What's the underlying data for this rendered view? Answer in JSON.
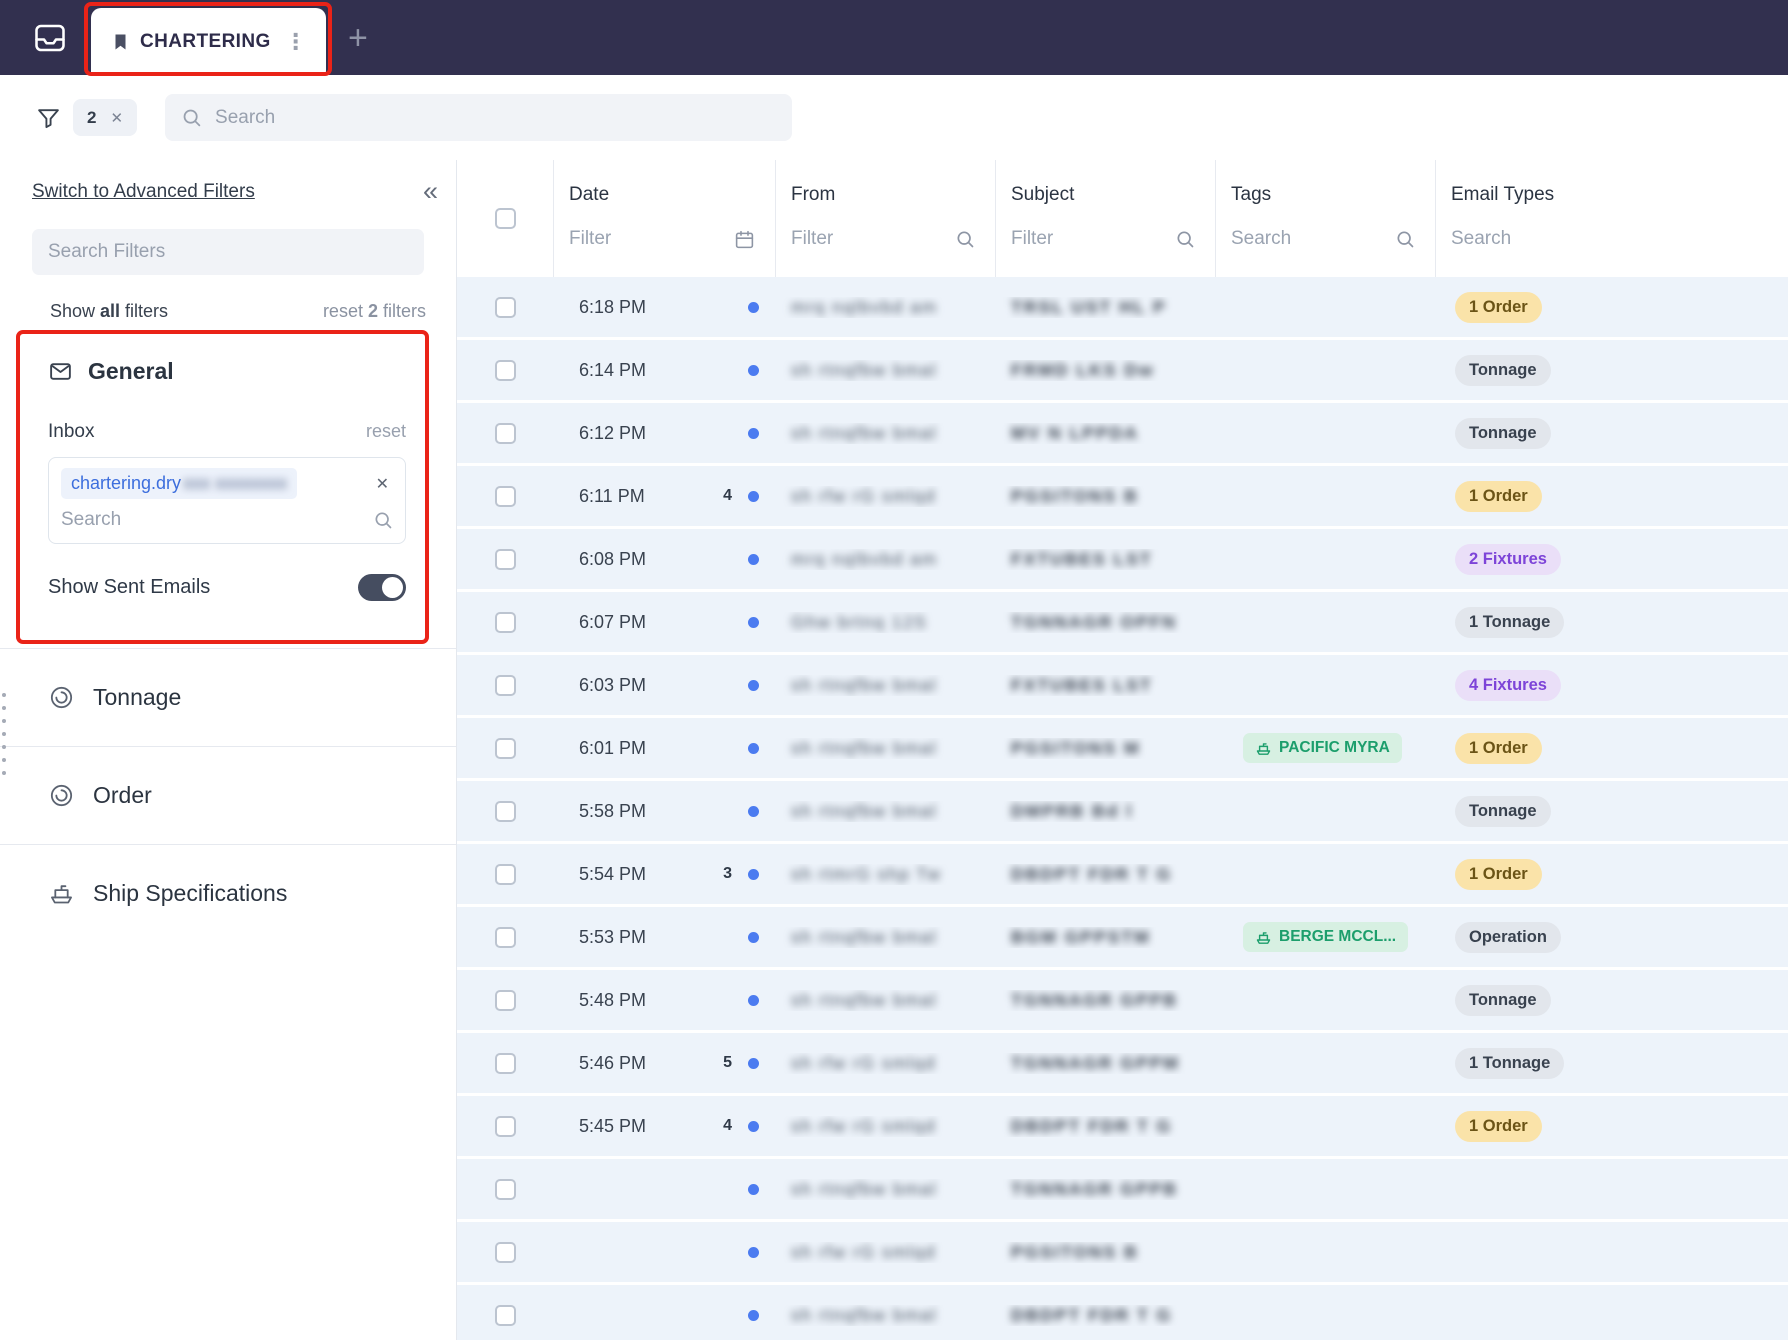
{
  "glyphs": {
    "collapse": "«",
    "kebab": "⋮",
    "plus": "+",
    "close": "✕"
  },
  "topbar": {
    "tab_label": "CHARTERING"
  },
  "filterbar": {
    "filter_count": "2",
    "search_placeholder": "Search"
  },
  "sidebar": {
    "advanced_filters_link": "Switch to Advanced Filters",
    "search_filters_placeholder": "Search Filters",
    "show_filters": {
      "pre": "Show ",
      "bold": "all",
      "post": " filters"
    },
    "reset_filters": {
      "pre": "reset ",
      "bold": "2",
      "post": " filters"
    },
    "general": {
      "title": "General",
      "inbox_label": "Inbox",
      "reset_label": "reset",
      "inbox_chip_text": "chartering.dry",
      "inbox_chip_redacted": "xxx xxxxxxxx",
      "inbox_search_placeholder": "Search",
      "show_sent_label": "Show Sent Emails",
      "show_sent_on": true
    },
    "sections": [
      {
        "label": "Tonnage",
        "icon": "spiral-icon"
      },
      {
        "label": "Order",
        "icon": "spiral-icon"
      },
      {
        "label": "Ship Specifications",
        "icon": "ship-icon"
      }
    ]
  },
  "table": {
    "columns": [
      {
        "label": "Date",
        "filter_placeholder": "Filter",
        "icon": "calendar-icon"
      },
      {
        "label": "From",
        "filter_placeholder": "Filter",
        "icon": "search-icon"
      },
      {
        "label": "Subject",
        "filter_placeholder": "Filter",
        "icon": "search-icon"
      },
      {
        "label": "Tags",
        "filter_placeholder": "Search",
        "icon": "search-icon"
      },
      {
        "label": "Email Types",
        "filter_placeholder": "Search",
        "icon": ""
      }
    ],
    "rows": [
      {
        "time": "6:18 PM",
        "count": "",
        "unread": true,
        "from_redacted": "mrq nqlbvbd am",
        "subject_redacted": "TRSL UST HL P",
        "tag": "",
        "type": "1 Order",
        "type_variant": "amber"
      },
      {
        "time": "6:14 PM",
        "count": "",
        "unread": true,
        "from_redacted": "sh rtnqfbw bmal",
        "subject_redacted": "FRMD LKS Dw",
        "tag": "",
        "type": "Tonnage",
        "type_variant": "gray"
      },
      {
        "time": "6:12 PM",
        "count": "",
        "unread": true,
        "from_redacted": "sh rtnqfbw bmal",
        "subject_redacted": "MV N LPPDA",
        "tag": "",
        "type": "Tonnage",
        "type_variant": "gray"
      },
      {
        "time": "6:11 PM",
        "count": "4",
        "unread": true,
        "from_redacted": "sh rfw rG smlqd",
        "subject_redacted": "PGSITONS B",
        "tag": "",
        "type": "1 Order",
        "type_variant": "amber"
      },
      {
        "time": "6:08 PM",
        "count": "",
        "unread": true,
        "from_redacted": "mrq nqlbvbd am",
        "subject_redacted": "FXTUBES LST",
        "tag": "",
        "type": "2 Fixtures",
        "type_variant": "purple"
      },
      {
        "time": "6:07 PM",
        "count": "",
        "unread": true,
        "from_redacted": "Ghw brtnq 12S",
        "subject_redacted": "TGNNAGR OPFN",
        "tag": "",
        "type": "1 Tonnage",
        "type_variant": "gray"
      },
      {
        "time": "6:03 PM",
        "count": "",
        "unread": true,
        "from_redacted": "sh rtnqfbw bmal",
        "subject_redacted": "FXTUBES LST",
        "tag": "",
        "type": "4 Fixtures",
        "type_variant": "purple"
      },
      {
        "time": "6:01 PM",
        "count": "",
        "unread": true,
        "from_redacted": "sh rtnqfbw bmal",
        "subject_redacted": "PGSITONS M",
        "tag": "PACIFIC MYRA",
        "type": "1 Order",
        "type_variant": "amber"
      },
      {
        "time": "5:58 PM",
        "count": "",
        "unread": true,
        "from_redacted": "sh rtnqfbw bmal",
        "subject_redacted": "DMPRB Bd l",
        "tag": "",
        "type": "Tonnage",
        "type_variant": "gray"
      },
      {
        "time": "5:54 PM",
        "count": "3",
        "unread": true,
        "from_redacted": "sh rtmrG shp Tw",
        "subject_redacted": "DBDPT FDR T G",
        "tag": "",
        "type": "1 Order",
        "type_variant": "amber"
      },
      {
        "time": "5:53 PM",
        "count": "",
        "unread": true,
        "from_redacted": "sh rtnqfbw bmal",
        "subject_redacted": "BGM GPPSTM",
        "tag": "BERGE MCCL...",
        "type": "Operation",
        "type_variant": "gray"
      },
      {
        "time": "5:48 PM",
        "count": "",
        "unread": true,
        "from_redacted": "sh rtnqfbw bmal",
        "subject_redacted": "TGNNAGR GPPB",
        "tag": "",
        "type": "Tonnage",
        "type_variant": "gray"
      },
      {
        "time": "5:46 PM",
        "count": "5",
        "unread": true,
        "from_redacted": "sh rfw rG smlqd",
        "subject_redacted": "TGNNAGR GPPM",
        "tag": "",
        "type": "1 Tonnage",
        "type_variant": "gray"
      },
      {
        "time": "5:45 PM",
        "count": "4",
        "unread": true,
        "from_redacted": "sh rfw rG smlqd",
        "subject_redacted": "DBDPT FDR T G",
        "tag": "",
        "type": "1 Order",
        "type_variant": "amber"
      },
      {
        "time": "",
        "count": "",
        "unread": true,
        "redact_time": true,
        "from_redacted": "sh rtnqfbw bmal",
        "subject_redacted": "TGNNAGR GPPB",
        "tag": "",
        "type": "",
        "type_variant": ""
      },
      {
        "time": "",
        "count": "",
        "unread": true,
        "redact_time": true,
        "from_redacted": "sh rfw rG smlqd",
        "subject_redacted": "PGSITONS B",
        "tag": "",
        "type": "",
        "type_variant": ""
      },
      {
        "time": "",
        "count": "",
        "unread": true,
        "redact_time": true,
        "from_redacted": "sh rtnqfbw bmal",
        "subject_redacted": "DBDPT FDR T G",
        "tag": "",
        "type": "",
        "type_variant": ""
      }
    ]
  },
  "colors": {
    "topbar": "#32304F",
    "annotation_red": "#EA2318",
    "unread_blue": "#4B7BF0",
    "row_blue": "#EDF3FA",
    "tag_green_bg": "#D7F0E2",
    "tag_green_text": "#1C9E6C",
    "type_amber_bg": "#FAE3A9",
    "type_gray_bg": "#E2E6EC",
    "type_purple_bg": "#EADFF8"
  }
}
